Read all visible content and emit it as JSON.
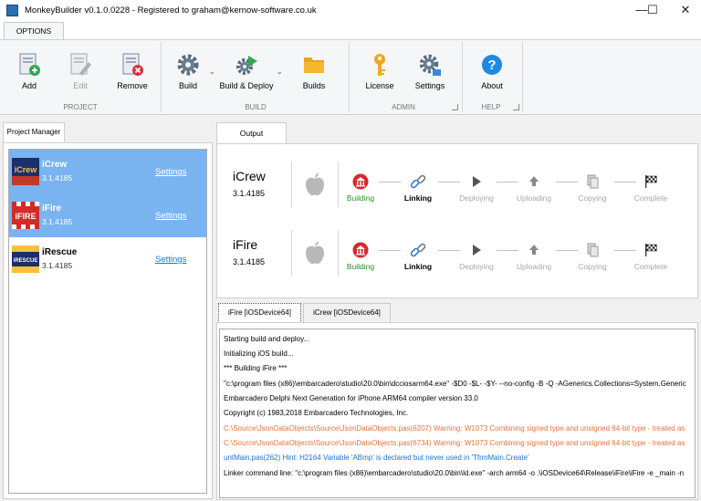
{
  "window": {
    "title": "MonkeyBuilder v0.1.0.0228  -  Registered to graham@kernow-software.co.uk",
    "minimize": "—",
    "maximize": "☐",
    "close": "✕"
  },
  "ribbon": {
    "tab": "OPTIONS",
    "groups": {
      "project": "PROJECT",
      "build": "BUILD",
      "admin": "ADMIN",
      "help": "HELP"
    },
    "buttons": {
      "add": "Add",
      "edit": "Edit",
      "remove": "Remove",
      "build": "Build",
      "build_deploy": "Build & Deploy",
      "builds": "Builds",
      "license": "License",
      "settings": "Settings",
      "about": "About"
    }
  },
  "project_manager": {
    "tab": "Project Manager",
    "projects": [
      {
        "name": "iCrew",
        "version": "3.1.4185",
        "settings": "Settings",
        "selected": true,
        "logo_text": "iCrew"
      },
      {
        "name": "iFire",
        "version": "3.1.4185",
        "settings": "Settings",
        "selected": true,
        "logo_text": "iFIRE"
      },
      {
        "name": "iRescue",
        "version": "3.1.4185",
        "settings": "Settings",
        "selected": false,
        "logo_text": "iRESCUE"
      }
    ]
  },
  "output": {
    "tab": "Output",
    "runs": [
      {
        "name": "iCrew",
        "version": "3.1.4185",
        "steps": [
          "Building",
          "Linking",
          "Deploying",
          "Uploading",
          "Copying",
          "Complete"
        ]
      },
      {
        "name": "iFire",
        "version": "3.1.4185",
        "steps": [
          "Building",
          "Linking",
          "Deploying",
          "Uploading",
          "Copying",
          "Complete"
        ]
      }
    ]
  },
  "log": {
    "tabs": [
      "iFire  [iOSDevice64]",
      "iCrew  [iOSDevice64]"
    ],
    "lines": [
      {
        "text": "Starting build and deploy...",
        "kind": "normal"
      },
      {
        "text": "Initializing iOS build...",
        "kind": "normal"
      },
      {
        "text": "*** Building iFire ***",
        "kind": "normal"
      },
      {
        "text": "\"c:\\program files (x86)\\embarcadero\\studio\\20.0\\bin\\dcciosarm64.exe\" -$D0 -$L- -$Y- --no-config -B -Q -AGenerics.Collections=System.Generic",
        "kind": "normal"
      },
      {
        "text": "Embarcadero Delphi Next Generation for iPhone ARM64 compiler version 33.0",
        "kind": "normal"
      },
      {
        "text": "Copyright (c) 1983,2018 Embarcadero Technologies, Inc.",
        "kind": "normal"
      },
      {
        "text": "C:\\Source\\JsonDataObjects\\Source\\JsonDataObjects.pas(6207) Warning: W1073 Combining signed type and unsigned 64-bit type - treated as",
        "kind": "warn"
      },
      {
        "text": "C:\\Source\\JsonDataObjects\\Source\\JsonDataObjects.pas(6734) Warning: W1073 Combining signed type and unsigned 64-bit type - treated as",
        "kind": "warn"
      },
      {
        "text": "untMain.pas(262) Hint: H2164 Variable 'ABmp' is declared but never used in 'TfrmMain.Create'",
        "kind": "hint"
      },
      {
        "text": "Linker command line: \"c:\\program files (x86)\\embarcadero\\studio\\20.0\\bin\\ld.exe\" -arch arm64 -o .\\iOSDevice64\\Release\\iFire\\iFire -e _main -n",
        "kind": "normal"
      }
    ]
  },
  "colors": {
    "selection": "#7ab4f0",
    "link": "#1a73d9",
    "building": "#2e8a2e",
    "warning": "#e8743c",
    "hint": "#1a73d9"
  }
}
